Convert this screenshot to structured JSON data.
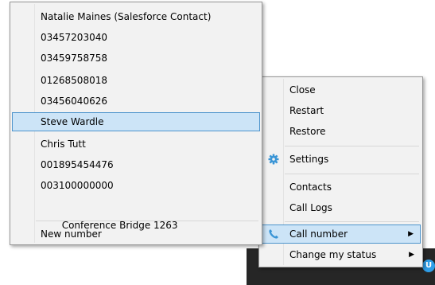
{
  "contact_menu": {
    "items": [
      {
        "label": "Natalie Maines (Salesforce Contact)"
      },
      {
        "label": "03457203040"
      },
      {
        "label": "03459758758"
      },
      {
        "label": "01268508018"
      },
      {
        "label": "03456040626"
      },
      {
        "label": "Steve Wardle",
        "selected": true
      },
      {
        "label": "Chris Tutt"
      },
      {
        "label": "001895454476"
      },
      {
        "label": "003100000000"
      },
      {
        "label": " Conference Bridge 1263"
      }
    ],
    "new_number_label": "New number"
  },
  "tray_menu": {
    "close_label": "Close",
    "restart_label": "Restart",
    "restore_label": "Restore",
    "settings_label": "Settings",
    "contacts_label": "Contacts",
    "call_logs_label": "Call Logs",
    "call_number_label": "Call number",
    "change_status_label": "Change my status",
    "submenu_arrow": "▶"
  },
  "tray": {
    "chevron": "ʌ",
    "app_badge": "U"
  },
  "colors": {
    "accent": "#2f9ee8",
    "selected_bg": "#cce4f7",
    "selected_border": "#4d94cc",
    "taskbar": "#262626"
  },
  "icons": {
    "settings": "gear-icon",
    "call_number": "phone-icon"
  }
}
